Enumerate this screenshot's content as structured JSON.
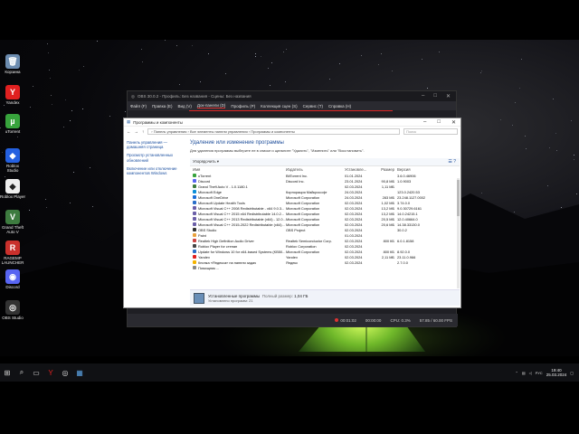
{
  "desktop_icons": [
    {
      "label": "Корзина",
      "color": "#6c8cb0",
      "glyph": "🗑"
    },
    {
      "label": "Yandex",
      "color": "#e02020",
      "glyph": "Y"
    },
    {
      "label": "uTorrent",
      "color": "#37a33c",
      "glyph": "µ"
    },
    {
      "label": "Roblox Studio",
      "color": "#2460e0",
      "glyph": "◆"
    },
    {
      "label": "Roblox Player",
      "color": "#eeeeee",
      "glyph": "◆"
    },
    {
      "label": "Grand Theft Auto V",
      "color": "#3d7b3f",
      "glyph": "V"
    },
    {
      "label": "RAGEMP LAUNCHER",
      "color": "#c9302c",
      "glyph": "R"
    },
    {
      "label": "Discord",
      "color": "#5865f2",
      "glyph": "◉"
    },
    {
      "label": "OBS Studio",
      "color": "#333333",
      "glyph": "◎"
    }
  ],
  "obs": {
    "title": "OBS 30.0.2 - Профиль: Без названия - Сцены: Без названия",
    "menu": [
      "Файл (F)",
      "Правка (E)",
      "Вид (V)",
      "Док-панели (D)",
      "Профиль (P)",
      "Коллекция сцен (S)",
      "Сервис (T)",
      "Справка (H)"
    ],
    "status": {
      "rec_time": "00:01:02",
      "rec_elapsed": "00:00:00",
      "cpu": "CPU: 0.3%",
      "fps": "57.85 / 60.00 FPS"
    }
  },
  "cp": {
    "title": "Программы и компоненты",
    "breadcrumb": "›  Панель управления  ›  Все элементы панели управления  ›  Программы и компоненты",
    "search_placeholder": "Поиск",
    "sidebar": [
      "Панель управления — домашняя страница",
      "Просмотр установленных обновлений",
      "Включение или отключение компонентов Windows"
    ],
    "heading": "Удаление или изменение программы",
    "description": "Для удаления программы выберите ее в списке и щелкните \"Удалить\", \"Изменить\" или \"Восстановить\".",
    "organize": "Упорядочить ▾",
    "columns": [
      "Имя",
      "Издатель",
      "Установле...",
      "Размер",
      "Версия"
    ],
    "rows": [
      {
        "name": "uTorrent",
        "pub": "BitTorrent Inc.",
        "date": "01.01.2024",
        "size": "",
        "ver": "3.6.0.46906",
        "color": "#37a33c"
      },
      {
        "name": "Discord",
        "pub": "Discord Inc.",
        "date": "23.01.2024",
        "size": "90,8 МБ",
        "ver": "1.0.9003",
        "color": "#5865f2"
      },
      {
        "name": "Grand Theft Auto V - 1.0.1180.1",
        "pub": "",
        "date": "02.03.2024",
        "size": "1,11 МБ",
        "ver": "",
        "color": "#3d7b3f"
      },
      {
        "name": "Microsoft Edge",
        "pub": "Корпорация Майкрософт",
        "date": "24.03.2024",
        "size": "",
        "ver": "123.0.2420.53",
        "color": "#0c8fd8"
      },
      {
        "name": "Microsoft OneDrive",
        "pub": "Microsoft Corporation",
        "date": "24.03.2024",
        "size": "283 МБ",
        "ver": "23.248.1127.0002",
        "color": "#1a6ed8"
      },
      {
        "name": "Microsoft Update Health Tools",
        "pub": "Microsoft Corporation",
        "date": "02.03.2024",
        "size": "1,02 МБ",
        "ver": "3.74.0.0",
        "color": "#2a6fc9"
      },
      {
        "name": "Microsoft Visual C++ 2008 Redistributable - x64 9.0.3...",
        "pub": "Microsoft Corporation",
        "date": "02.03.2024",
        "size": "13,2 МБ",
        "ver": "9.0.30729.6161",
        "color": "#6b5fa8"
      },
      {
        "name": "Microsoft Visual C++ 2015 x64 Redistributable 14.0.2...",
        "pub": "Microsoft Corporation",
        "date": "02.03.2024",
        "size": "13,2 МБ",
        "ver": "14.0.24215.1",
        "color": "#6b5fa8"
      },
      {
        "name": "Microsoft Visual C++ 2013 Redistributable (x64) - 12.0...",
        "pub": "Microsoft Corporation",
        "date": "02.03.2024",
        "size": "20,5 МБ",
        "ver": "12.0.40664.0",
        "color": "#6b5fa8"
      },
      {
        "name": "Microsoft Visual C++ 2015-2022 Redistributable (x64)...",
        "pub": "Microsoft Corporation",
        "date": "02.03.2024",
        "size": "20,6 МБ",
        "ver": "14.38.33130.0",
        "color": "#6b5fa8"
      },
      {
        "name": "OBS Studio",
        "pub": "OBS Project",
        "date": "02.03.2024",
        "size": "",
        "ver": "30.0.2",
        "color": "#333333"
      },
      {
        "name": "Paint",
        "pub": "",
        "date": "01.03.2024",
        "size": "",
        "ver": "",
        "color": "#e9a13b"
      },
      {
        "name": "Realtek High Definition Audio Driver",
        "pub": "Realtek Semiconductor Corp.",
        "date": "02.03.2024",
        "size": "800 КБ",
        "ver": "6.0.1.8158",
        "color": "#c44"
      },
      {
        "name": "Roblox Player for степан",
        "pub": "Roblox Corporation",
        "date": "02.03.2024",
        "size": "",
        "ver": "",
        "color": "#444"
      },
      {
        "name": "Update for Windows 10 for x64-based Systems (KB50...",
        "pub": "Microsoft Corporation",
        "date": "02.03.2024",
        "size": "800 КБ",
        "ver": "8.92.0.0",
        "color": "#2a6fc9"
      },
      {
        "name": "Yandex",
        "pub": "Yandex",
        "date": "02.03.2024",
        "size": "2,11 МБ",
        "ver": "23.11.0.966",
        "color": "#e02020"
      },
      {
        "name": "Кнопка «Яндекса» на панели задач",
        "pub": "Яндекс",
        "date": "02.03.2024",
        "size": "",
        "ver": "2.7.0.0",
        "color": "#f5b400"
      },
      {
        "name": "Помощник ...",
        "pub": "",
        "date": "",
        "size": "",
        "ver": "",
        "color": "#888"
      }
    ],
    "footer": {
      "t1": "Установленные программы",
      "t1b": "Полный размер:",
      "size": "1,04 ГБ",
      "t2": "Установлено программ: 21"
    }
  },
  "taskbar": {
    "time": "19:40",
    "date": "25.03.2024",
    "lang": "РУС"
  }
}
